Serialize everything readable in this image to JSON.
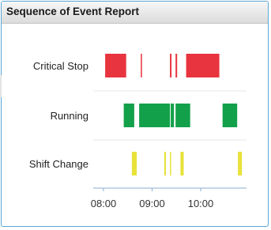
{
  "panel": {
    "title": "Sequence of Event Report"
  },
  "colors": {
    "border": "#5aa7d6",
    "axis": "#8aaed0",
    "gridline": "#e6e6e6",
    "label": "#222222",
    "tick_label": "#333333"
  },
  "chart_data": {
    "type": "timeline",
    "title": "Sequence of Event Report",
    "x_axis": {
      "ticks": [
        "08:00",
        "09:00",
        "10:00"
      ],
      "range": [
        "07:50",
        "10:40"
      ]
    },
    "categories": [
      "Critical Stop",
      "Running",
      "Shift Change"
    ],
    "grid": "horizontal separators between rows",
    "series": [
      {
        "category": "Critical Stop",
        "color": "#e8343e",
        "segments": [
          {
            "start": "08:02",
            "end": "08:28"
          },
          {
            "start": "08:46",
            "end": "08:47"
          },
          {
            "start": "09:22",
            "end": "09:24"
          },
          {
            "start": "09:29",
            "end": "09:31"
          },
          {
            "start": "09:42",
            "end": "10:23"
          }
        ]
      },
      {
        "category": "Running",
        "color": "#13a04a",
        "segments": [
          {
            "start": "08:25",
            "end": "08:38"
          },
          {
            "start": "08:44",
            "end": "09:22"
          },
          {
            "start": "09:23",
            "end": "09:27"
          },
          {
            "start": "09:29",
            "end": "09:47"
          },
          {
            "start": "10:27",
            "end": "10:45"
          }
        ]
      },
      {
        "category": "Shift Change",
        "color": "#e8e23a",
        "segments": [
          {
            "start": "08:35",
            "end": "08:41"
          },
          {
            "start": "09:15",
            "end": "09:17"
          },
          {
            "start": "09:22",
            "end": "09:23"
          },
          {
            "start": "09:35",
            "end": "09:39"
          },
          {
            "start": "10:46",
            "end": "10:51"
          }
        ]
      }
    ]
  }
}
